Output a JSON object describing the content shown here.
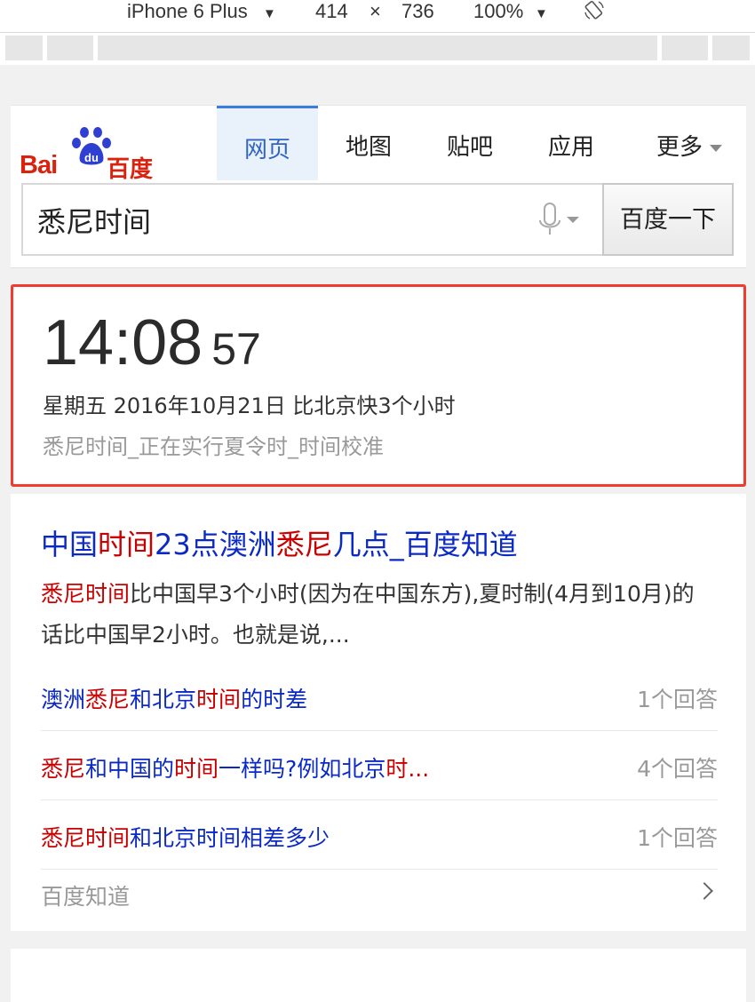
{
  "device_toolbar": {
    "device": "iPhone 6 Plus",
    "width": "414",
    "times": "×",
    "height": "736",
    "zoom": "100%"
  },
  "header": {
    "logo": {
      "bai": "Bai",
      "du": "du",
      "cn": "百度"
    },
    "tabs": [
      {
        "label": "网页",
        "active": true
      },
      {
        "label": "地图"
      },
      {
        "label": "贴吧"
      },
      {
        "label": "应用"
      },
      {
        "label": "更多"
      }
    ]
  },
  "search": {
    "value": "悉尼时间",
    "button_label": "百度一下"
  },
  "time_card": {
    "hm": "14:08",
    "seconds": "57",
    "date_line": "星期五 2016年10月21日 比北京快3个小时",
    "sub_line": "悉尼时间_正在实行夏令时_时间校准"
  },
  "result": {
    "title": {
      "a": "中国",
      "b": "时间",
      "c": "23点澳洲",
      "d": "悉尼",
      "e": "几点_百度知道"
    },
    "abstract": {
      "hl": "悉尼时间",
      "rest": "比中国早3个小时(因为在中国东方),夏时制(4月到10月)的话比中国早2小时。也就是说,..."
    },
    "qa": [
      {
        "q1": "澳洲",
        "q2": "悉尼",
        "q3": "和北京",
        "q4": "时间",
        "q5": "的时差",
        "answers": "1个回答"
      },
      {
        "q1": "悉尼",
        "q2": "和中国的",
        "q3": "时间",
        "q4": "一样吗?例如北京",
        "q5": "时...",
        "answers": "4个回答"
      },
      {
        "q1": "悉尼时间",
        "q2": "和北京时间相差多少",
        "answers": "1个回答"
      }
    ],
    "source": "百度知道"
  },
  "colors": {
    "highlight": "#c90000",
    "link": "#0b2ac5",
    "accent_border": "#f23b2e",
    "logo_red": "#d9230f",
    "logo_blue": "#2f3fd1"
  }
}
